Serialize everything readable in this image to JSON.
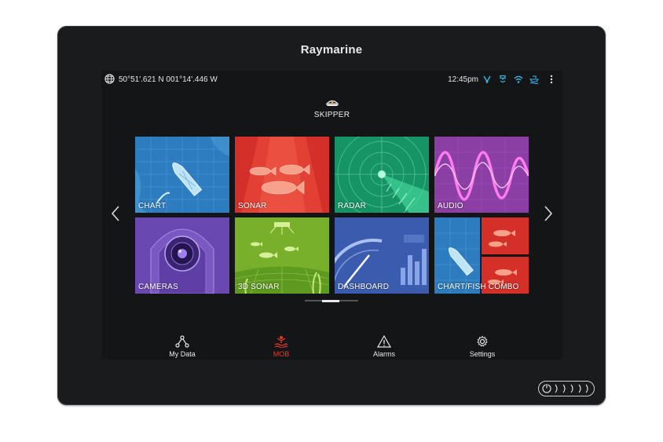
{
  "device": {
    "brand": "Raymarine"
  },
  "status_bar": {
    "coordinates": "50°51'.621 N   001°14'.446 W",
    "time": "12:45pm",
    "icons": [
      "globe-icon",
      "gps-icon",
      "sonar-icon",
      "wifi-icon",
      "boat-icon",
      "more-vertical-icon"
    ]
  },
  "profile": {
    "name": "SKIPPER",
    "icon": "captain-hat-icon"
  },
  "tiles": [
    {
      "label": "CHART"
    },
    {
      "label": "SONAR"
    },
    {
      "label": "RADAR"
    },
    {
      "label": "AUDIO"
    },
    {
      "label": "CAMERAS"
    },
    {
      "label": "3D SONAR"
    },
    {
      "label": "DASHBOARD"
    },
    {
      "label": "CHART/FISH COMBO"
    }
  ],
  "pager": {
    "pages": 3,
    "current": 2
  },
  "bottom_bar": [
    {
      "label": "My Data",
      "icon": "share-nodes-icon"
    },
    {
      "label": "MOB",
      "icon": "man-overboard-icon",
      "color": "#e53a2a"
    },
    {
      "label": "Alarms",
      "icon": "warning-triangle-icon"
    },
    {
      "label": "Settings",
      "icon": "gear-icon"
    }
  ],
  "colors": {
    "chart": "#2f7fc0",
    "sonar": "#d9322b",
    "radar": "#1d9c6a",
    "audio": "#8a3fa0",
    "cameras": "#6a47b0",
    "sonar3d": "#7fb52f",
    "dashboard": "#3c5db0"
  }
}
